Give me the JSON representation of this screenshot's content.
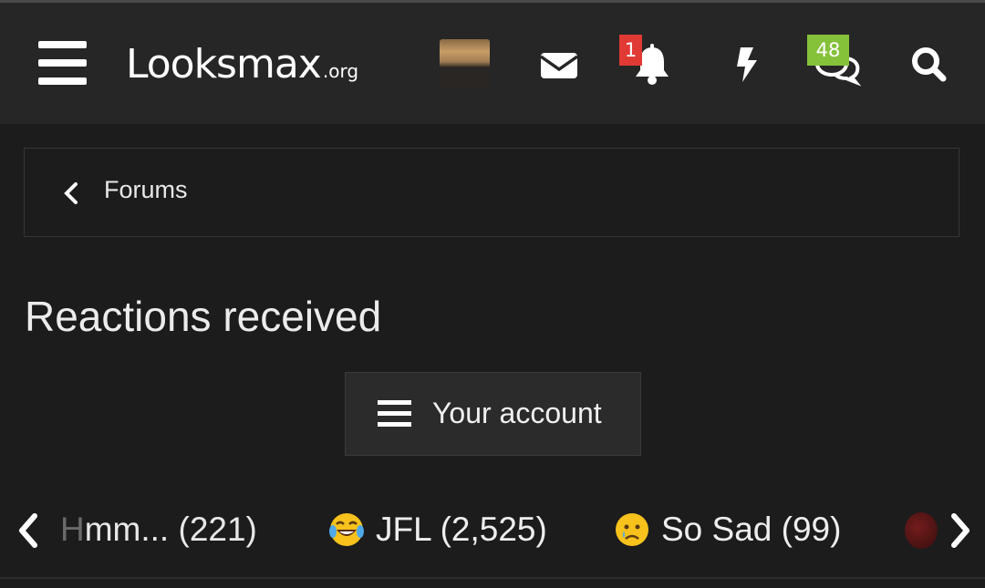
{
  "header": {
    "logo_main": "Looksmax",
    "logo_tld": ".org",
    "notifications_count": "1",
    "conversations_count": "48"
  },
  "breadcrumb": {
    "label": "Forums"
  },
  "page": {
    "title": "Reactions received"
  },
  "account_menu": {
    "label": "Your account"
  },
  "reaction_tabs": [
    {
      "label_first": "H",
      "label_rest": "mm... (221)",
      "icon": "hmm-icon"
    },
    {
      "label": "JFL (2,525)",
      "icon": "laughing-crying-emoji-icon"
    },
    {
      "label": "So Sad (99)",
      "icon": "sad-emoji-icon"
    }
  ],
  "colors": {
    "background": "#1c1c1c",
    "header_bg": "#262626",
    "badge_red": "#e13a35",
    "badge_green": "#86c13a"
  }
}
